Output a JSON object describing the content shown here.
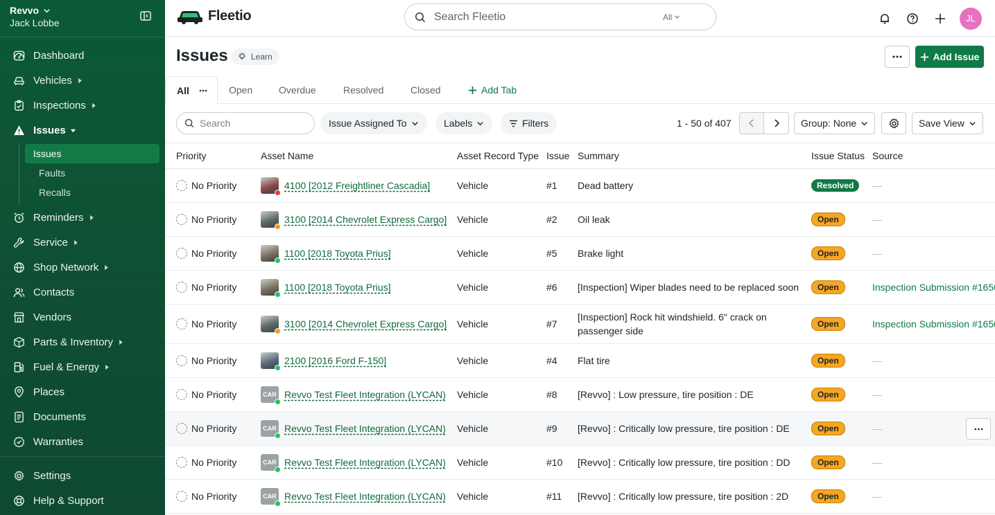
{
  "account": {
    "org": "Revvo",
    "user": "Jack Lobbe"
  },
  "nav": {
    "items": [
      {
        "label": "Dashboard",
        "icon": "dashboard-icon",
        "caret": false
      },
      {
        "label": "Vehicles",
        "icon": "vehicle-icon",
        "caret": true
      },
      {
        "label": "Inspections",
        "icon": "clipboard-check-icon",
        "caret": true
      },
      {
        "label": "Issues",
        "icon": "warning-icon",
        "caret": true,
        "active": true
      }
    ],
    "sub_items": [
      "Issues",
      "Faults",
      "Recalls"
    ],
    "items_after": [
      {
        "label": "Reminders",
        "icon": "reminder-icon",
        "caret": true
      },
      {
        "label": "Service",
        "icon": "wrench-icon",
        "caret": true
      },
      {
        "label": "Shop Network",
        "icon": "globe-icon",
        "caret": true
      },
      {
        "label": "Contacts",
        "icon": "contacts-icon",
        "caret": false
      },
      {
        "label": "Vendors",
        "icon": "store-icon",
        "caret": false
      },
      {
        "label": "Parts & Inventory",
        "icon": "box-icon",
        "caret": true
      },
      {
        "label": "Fuel & Energy",
        "icon": "fuel-icon",
        "caret": true
      },
      {
        "label": "Places",
        "icon": "map-pin-icon",
        "caret": false
      },
      {
        "label": "Documents",
        "icon": "document-icon",
        "caret": false
      },
      {
        "label": "Warranties",
        "icon": "badge-check-icon",
        "caret": false
      }
    ],
    "bottom": [
      {
        "label": "Settings",
        "icon": "gear-icon"
      },
      {
        "label": "Help & Support",
        "icon": "help-icon"
      }
    ]
  },
  "topbar": {
    "brand": "Fleetio",
    "search_placeholder": "Search Fleetio",
    "search_scope": "All",
    "avatar_initials": "JL"
  },
  "page": {
    "title": "Issues",
    "learn_label": "Learn",
    "add_label": "Add Issue"
  },
  "tabs": {
    "active": "All",
    "items": [
      "Open",
      "Overdue",
      "Resolved",
      "Closed"
    ],
    "add_label": "Add Tab"
  },
  "filters": {
    "search_placeholder": "Search",
    "assigned_label": "Issue Assigned To",
    "labels_label": "Labels",
    "filters_label": "Filters",
    "page_count": "1 - 50 of 407",
    "group_label": "Group: None",
    "save_view_label": "Save View"
  },
  "table": {
    "headers": [
      "Priority",
      "Asset Name",
      "Asset Record Type",
      "Issue",
      "Summary",
      "Issue Status",
      "Source"
    ],
    "rows": [
      {
        "priority": "No Priority",
        "asset": "4100 [2012 Freightliner Cascadia]",
        "thumb": "#8a4a46",
        "dot": "#e03b3b",
        "car": false,
        "type": "Vehicle",
        "num": "#1",
        "summary": "Dead battery",
        "status": "Resolved",
        "status_kind": "resolved",
        "source": "—",
        "source_link": false
      },
      {
        "priority": "No Priority",
        "asset": "3100 [2014 Chevrolet Express Cargo]",
        "thumb": "#5a6a64",
        "dot": "#f29b1d",
        "car": false,
        "type": "Vehicle",
        "num": "#2",
        "summary": "Oil leak",
        "status": "Open",
        "status_kind": "open",
        "source": "—",
        "source_link": false
      },
      {
        "priority": "No Priority",
        "asset": "1100 [2018 Toyota Prius]",
        "thumb": "#7b7060",
        "dot": "#22c55e",
        "car": false,
        "type": "Vehicle",
        "num": "#5",
        "summary": "Brake light",
        "status": "Open",
        "status_kind": "open",
        "source": "—",
        "source_link": false
      },
      {
        "priority": "No Priority",
        "asset": "1100 [2018 Toyota Prius]",
        "thumb": "#7b7060",
        "dot": "#22c55e",
        "car": false,
        "type": "Vehicle",
        "num": "#6",
        "summary": "[Inspection] Wiper blades need to be replaced soon",
        "status": "Open",
        "status_kind": "open",
        "source": "Inspection Submission #1650",
        "source_link": true
      },
      {
        "priority": "No Priority",
        "asset": "3100 [2014 Chevrolet Express Cargo]",
        "thumb": "#5a6a64",
        "dot": "#f29b1d",
        "car": false,
        "type": "Vehicle",
        "num": "#7",
        "summary": "[Inspection] Rock hit windshield. 6\" crack on passenger side",
        "status": "Open",
        "status_kind": "open",
        "source": "Inspection Submission #1650",
        "source_link": true,
        "tall": true
      },
      {
        "priority": "No Priority",
        "asset": "2100 [2016 Ford F-150]",
        "thumb": "#5c6a80",
        "dot": "#22c55e",
        "car": false,
        "type": "Vehicle",
        "num": "#4",
        "summary": "Flat tire",
        "status": "Open",
        "status_kind": "open",
        "source": "—",
        "source_link": false
      },
      {
        "priority": "No Priority",
        "asset": "Revvo Test Fleet Integration (LYCAN)",
        "thumb": "#9aa2a6",
        "dot": "#22c55e",
        "car": true,
        "car_text": "CAR",
        "type": "Vehicle",
        "num": "#8",
        "summary": "[Revvo] : Low pressure, tire position : DE",
        "status": "Open",
        "status_kind": "open",
        "source": "—",
        "source_link": false
      },
      {
        "priority": "No Priority",
        "asset": "Revvo Test Fleet Integration (LYCAN)",
        "thumb": "#9aa2a6",
        "dot": "#22c55e",
        "car": true,
        "car_text": "CAR",
        "type": "Vehicle",
        "num": "#9",
        "summary": "[Revvo] : Critically low pressure, tire position : DE",
        "status": "Open",
        "status_kind": "open",
        "source": "—",
        "source_link": false,
        "hover": true
      },
      {
        "priority": "No Priority",
        "asset": "Revvo Test Fleet Integration (LYCAN)",
        "thumb": "#9aa2a6",
        "dot": "#22c55e",
        "car": true,
        "car_text": "CAR",
        "type": "Vehicle",
        "num": "#10",
        "summary": "[Revvo] : Critically low pressure, tire position : DD",
        "status": "Open",
        "status_kind": "open",
        "source": "—",
        "source_link": false
      },
      {
        "priority": "No Priority",
        "asset": "Revvo Test Fleet Integration (LYCAN)",
        "thumb": "#9aa2a6",
        "dot": "#22c55e",
        "car": true,
        "car_text": "CAR",
        "type": "Vehicle",
        "num": "#11",
        "summary": "[Revvo] : Critically low pressure, tire position : 2D",
        "status": "Open",
        "status_kind": "open",
        "source": "—",
        "source_link": false
      }
    ]
  },
  "colors": {
    "brand_green": "#0f7a45",
    "sidebar": "#0c5a36",
    "open_badge": "#f5a623",
    "avatar": "#e872c2"
  }
}
